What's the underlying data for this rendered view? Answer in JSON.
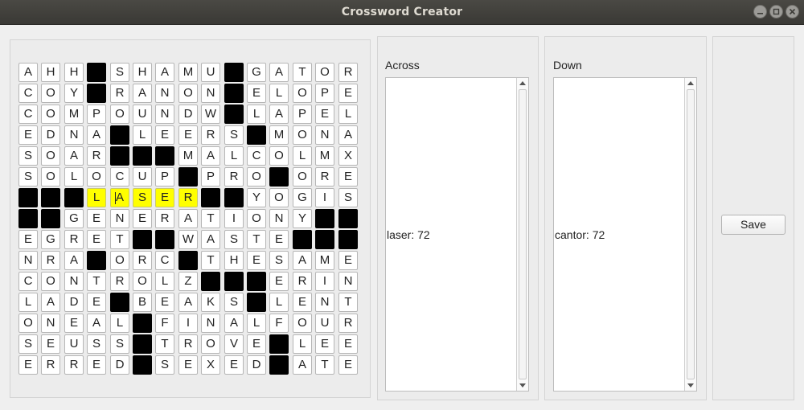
{
  "window": {
    "title": "Crossword Creator"
  },
  "grid": {
    "rows": [
      "AHH#SHAMU#GATOR",
      "COY#RANON#ELOPE",
      "COMPOUNDW#LAPEL",
      "EDNA#LEERS#MONA",
      "SOAR###MALCOLMX",
      "SOLOCUP#PRO#ORE",
      "###LASER##YOGIS",
      "##GENERATIONY##",
      "EGRET##WASTE###",
      "NRA#ORC#THESAME",
      "CONTROLZ###ERIN",
      "LADE#BEAKS#LENT",
      "ONEAL#FINALFOUR",
      "SEUSS#TROVE#LEE",
      "ERRED#SEXED#ATE"
    ],
    "highlight": {
      "row": 6,
      "cols": [
        3,
        4,
        5,
        6,
        7
      ]
    },
    "cursor": {
      "row": 6,
      "col": 4
    },
    "highlight_color": "#ffff00"
  },
  "across": {
    "label": "Across",
    "entries": [
      "laser: 72"
    ]
  },
  "down": {
    "label": "Down",
    "entries": [
      "cantor: 72"
    ]
  },
  "save_label": "Save"
}
